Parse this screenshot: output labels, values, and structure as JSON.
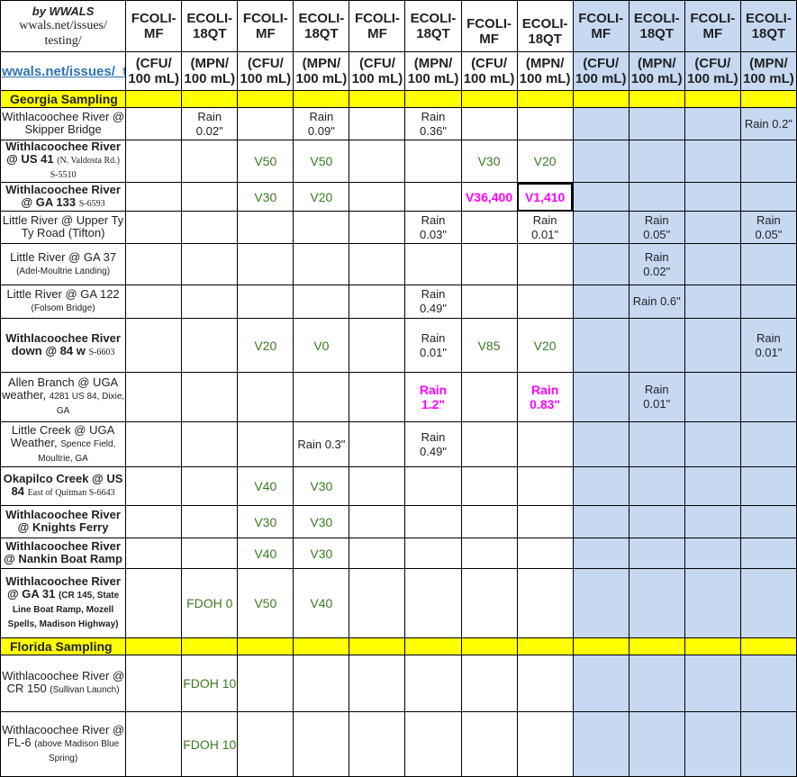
{
  "header": {
    "by_text": "by WWALS",
    "url_text": "wwals.net/issues/ testing/",
    "link_text": "wwals.net/issues/_testin",
    "columns": [
      "FCOLI-MF",
      "ECOLI-18QT",
      "FCOLI-MF",
      "ECOLI-18QT",
      "FCOLI-MF",
      "ECOLI-18QT",
      "FCOLI-MF",
      "ECOLI-18QT",
      "FCOLI-MF",
      "ECOLI-18QT",
      "FCOLI-MF",
      "ECOLI-18QT"
    ],
    "units": [
      "(CFU/ 100 mL)",
      "(MPN/ 100 mL)",
      "(CFU/ 100 mL)",
      "(MPN/ 100 mL)",
      "(CFU/ 100 mL)",
      "(MPN/ 100 mL)",
      "(CFU/ 100 mL)",
      "(MPN/ 100 mL)",
      "(CFU/ 100 mL)",
      "(MPN/ 100 mL)",
      "(CFU/ 100 mL)",
      "(MPN/ 100 mL)"
    ]
  },
  "sections": {
    "georgia": "Georgia Sampling",
    "florida": "Florida Sampling"
  },
  "colors": {
    "highlight": "#ffff00",
    "shaded_columns": "#c6d9f1",
    "value_green": "#3b7a1f",
    "value_magenta": "#ff00ff"
  },
  "rows": [
    {
      "site_main": "Withlacoochee River @ Skipper Bridge",
      "site_sub": "",
      "cells": [
        "",
        "Rain 0.02\"",
        "",
        "Rain 0.09\"",
        "",
        "Rain 0.36\"",
        "",
        "",
        "",
        "",
        "",
        "Rain 0.2\""
      ]
    },
    {
      "site_main": "Withlacoochee River @ US 41",
      "site_sub": "(N. Valdosta Rd.) S-5510",
      "cells": [
        "",
        "",
        "V50",
        "V50",
        "",
        "",
        "V30",
        "V20",
        "",
        "",
        "",
        ""
      ]
    },
    {
      "site_main": "Withlacoochee River @ GA 133",
      "site_sub": "S-6593",
      "cells": [
        "",
        "",
        "V30",
        "V20",
        "",
        "",
        "V36,400",
        "V1,410",
        "",
        "",
        "",
        ""
      ]
    },
    {
      "site_main": "Little River @ Upper Ty Ty Road (Tifton)",
      "site_sub": "",
      "cells": [
        "",
        "",
        "",
        "",
        "",
        "Rain 0.03\"",
        "",
        "Rain 0.01\"",
        "",
        "Rain 0.05\"",
        "",
        "Rain 0.05\""
      ]
    },
    {
      "site_main": "Little River @ GA 37",
      "site_sub": "(Adel-Moultrie Landing)",
      "cells": [
        "",
        "",
        "",
        "",
        "",
        "",
        "",
        "",
        "",
        "Rain 0.02\"",
        "",
        ""
      ]
    },
    {
      "site_main": "Little River @ GA 122",
      "site_sub": "(Folsom Bridge)",
      "cells": [
        "",
        "",
        "",
        "",
        "",
        "Rain 0.49\"",
        "",
        "",
        "",
        "Rain 0.6\"",
        "",
        ""
      ]
    },
    {
      "site_main": "Withlacoochee River down @ 84 w",
      "site_sub": "S-6603",
      "cells": [
        "",
        "",
        "V20",
        "V0",
        "",
        "Rain 0.01\"",
        "V85",
        "V20",
        "",
        "",
        "",
        "Rain 0.01\""
      ]
    },
    {
      "site_main": "Allen Branch @ UGA weather,",
      "site_sub": "4281 US 84, Dixie, GA",
      "cells": [
        "",
        "",
        "",
        "",
        "",
        "Rain 1.2\"",
        "",
        "Rain 0.83\"",
        "",
        "Rain 0.01\"",
        "",
        ""
      ]
    },
    {
      "site_main": "Little Creek @ UGA Weather,",
      "site_sub": "Spence Field, Moultrie, GA",
      "cells": [
        "",
        "",
        "",
        "Rain 0.3\"",
        "",
        "Rain 0.49\"",
        "",
        "",
        "",
        "",
        "",
        ""
      ]
    },
    {
      "site_main": "Okapilco Creek @ US 84",
      "site_sub": "East of Quitman S-6643",
      "cells": [
        "",
        "",
        "V40",
        "V30",
        "",
        "",
        "",
        "",
        "",
        "",
        "",
        ""
      ]
    },
    {
      "site_main": "Withlacoochee River @ Knights Ferry",
      "site_sub": "",
      "cells": [
        "",
        "",
        "V30",
        "V30",
        "",
        "",
        "",
        "",
        "",
        "",
        "",
        ""
      ]
    },
    {
      "site_main": "Withlacoochee River @ Nankin Boat Ramp",
      "site_sub": "",
      "cells": [
        "",
        "",
        "V40",
        "V30",
        "",
        "",
        "",
        "",
        "",
        "",
        "",
        ""
      ]
    },
    {
      "site_main": "Withlacoochee River @ GA 31",
      "site_sub": "(CR 145, State Line Boat Ramp, Mozell Spells, Madison Highway)",
      "cells": [
        "",
        "FDOH 0",
        "V50",
        "V40",
        "",
        "",
        "",
        "",
        "",
        "",
        "",
        ""
      ]
    },
    {
      "site_main": "Withlacoochee River @ CR 150",
      "site_sub": "(Sullivan Launch)",
      "cells": [
        "",
        "FDOH 10",
        "",
        "",
        "",
        "",
        "",
        "",
        "",
        "",
        "",
        ""
      ]
    },
    {
      "site_main": "Withlacoochee River @ FL-6",
      "site_sub": "(above Madison Blue Spring)",
      "cells": [
        "",
        "FDOH 10",
        "",
        "",
        "",
        "",
        "",
        "",
        "",
        "",
        "",
        ""
      ]
    }
  ]
}
